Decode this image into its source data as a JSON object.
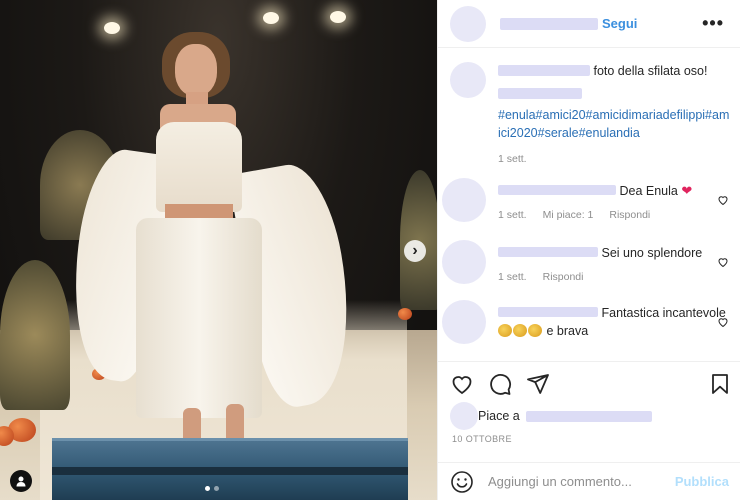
{
  "post": {
    "header": {
      "follow_label": "Segui",
      "more_icon": "more-options-icon"
    },
    "caption": {
      "text": "foto della sfilata oso!",
      "hashtags": "#enula#amici20#amicidimariadefilippi#amici2020#serale#enulandia",
      "time": "1 sett."
    },
    "comments": [
      {
        "text": "Dea Enula",
        "emoji": "❤",
        "time": "1 sett.",
        "likes": "Mi piace: 1",
        "reply": "Rispondi"
      },
      {
        "text": "Sei uno splendore",
        "time": "1 sett.",
        "reply": "Rispondi"
      },
      {
        "text": "Fantastica incantevole",
        "text_after": "e brava"
      }
    ],
    "likes_prefix": "Piace a",
    "date": "10 OTTOBRE",
    "compose": {
      "placeholder": "Aggiungi un commento...",
      "publish_label": "Pubblica"
    },
    "media": {
      "next_icon": "chevron-right-icon",
      "carousel_count": 2,
      "active_index": 0
    }
  },
  "colors": {
    "link_blue": "#3b8fde",
    "hashtag_blue": "#2a6fb5",
    "publish_blue": "#b2dffc",
    "heart_red": "#e0245e"
  }
}
